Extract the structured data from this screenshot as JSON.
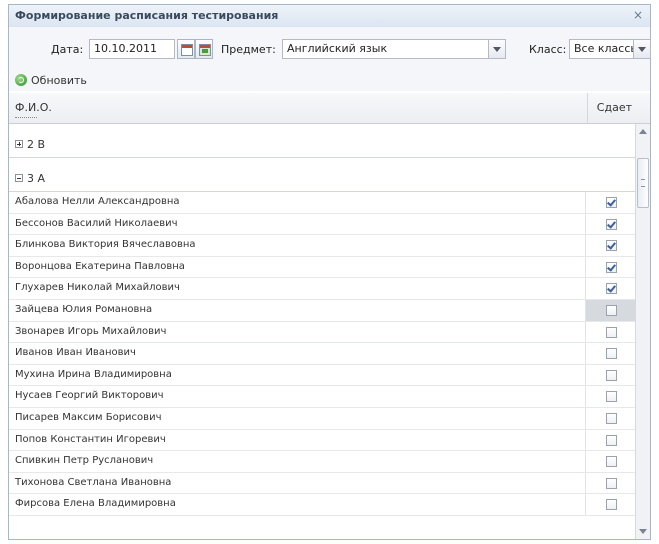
{
  "window": {
    "title": "Формирование расписания тестирования",
    "close_icon": "close-icon"
  },
  "filters": {
    "date_label": "Дата:",
    "date_value": "10.10.2011",
    "subject_label": "Предмет:",
    "subject_value": "Английский язык",
    "class_label": "Класс:",
    "class_value": "Все классы"
  },
  "toolbar": {
    "refresh_label": "Обновить"
  },
  "grid": {
    "col_name": "Ф.И.О.",
    "col_pass": "Сдает",
    "groups": [
      {
        "label": "2 В",
        "expanded": false
      },
      {
        "label": "3 А",
        "expanded": true
      }
    ],
    "rows": [
      {
        "name": "Абалова Нелли Александровна",
        "checked": true
      },
      {
        "name": "Бессонов Василий Николаевич",
        "checked": true
      },
      {
        "name": "Блинкова Виктория Вячеславовна",
        "checked": true
      },
      {
        "name": "Воронцова Екатерина Павловна",
        "checked": true
      },
      {
        "name": "Глухарев Николай Михайлович",
        "checked": true
      },
      {
        "name": "Зайцева Юлия Романовна",
        "checked": false,
        "selected": true
      },
      {
        "name": "Звонарев Игорь Михайлович",
        "checked": false
      },
      {
        "name": "Иванов Иван Иванович",
        "checked": false
      },
      {
        "name": "Мухина Ирина Владимировна",
        "checked": false
      },
      {
        "name": "Нусаев Георгий Викторович",
        "checked": false
      },
      {
        "name": "Писарев Максим Борисович",
        "checked": false
      },
      {
        "name": "Попов Константин Игоревич",
        "checked": false
      },
      {
        "name": "Спивкин Петр Русланович",
        "checked": false
      },
      {
        "name": "Тихонова Светлана Ивановна",
        "checked": false
      },
      {
        "name": "Фирсова Елена Владимировна",
        "checked": false
      }
    ]
  }
}
